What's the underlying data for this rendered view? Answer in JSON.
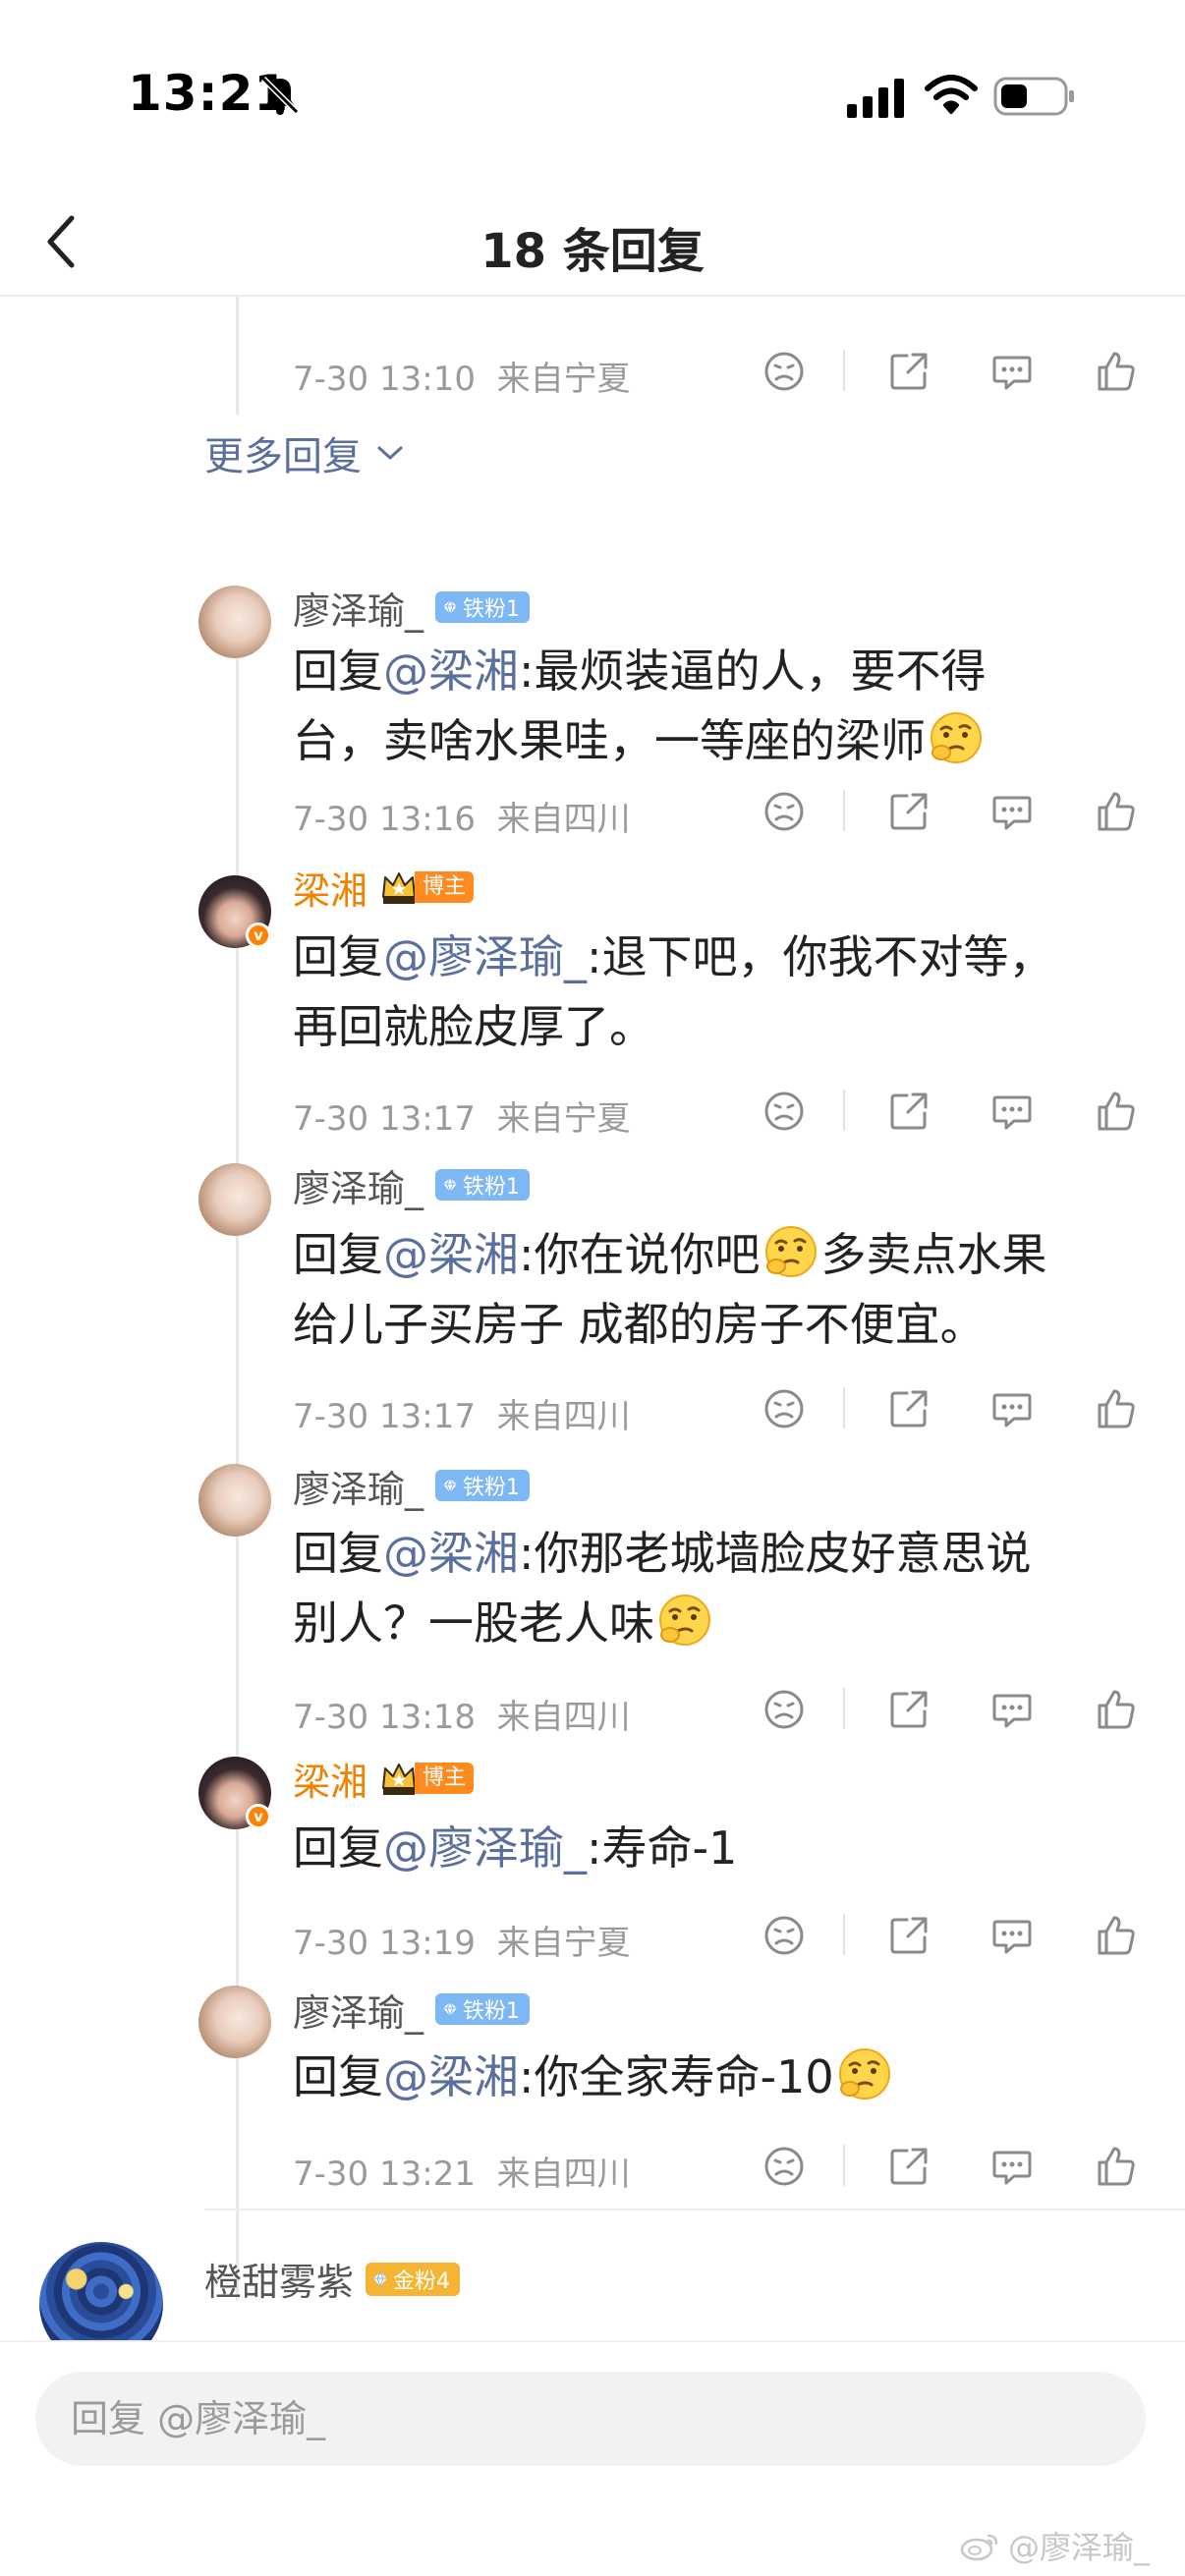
{
  "status_bar": {
    "time": "13:21"
  },
  "nav": {
    "title": "18 条回复"
  },
  "top_meta": {
    "date": "7-30 13:10",
    "location": "来自宁夏"
  },
  "more_replies": "更多回复",
  "replies": [
    {
      "name": "廖泽瑜_",
      "badge": "铁粉1",
      "prefix": "回复",
      "mention": "@梁湘",
      "line1": ":最烦装逼的人，要不得",
      "line2": "台，卖啥水果哇，一等座的梁师",
      "date": "7-30 13:16",
      "location": "来自四川"
    },
    {
      "name": "梁湘",
      "badge": "博主",
      "prefix": "回复",
      "mention": "@廖泽瑜_",
      "line1": ":退下吧，你我不对等，",
      "line2": "再回就脸皮厚了。",
      "date": "7-30 13:17",
      "location": "来自宁夏"
    },
    {
      "name": "廖泽瑜_",
      "badge": "铁粉1",
      "prefix": "回复",
      "mention": "@梁湘",
      "line1a": ":你在说你吧",
      "line1b": "多卖点水果",
      "line2": "给儿子买房子 成都的房子不便宜。",
      "date": "7-30 13:17",
      "location": "来自四川"
    },
    {
      "name": "廖泽瑜_",
      "badge": "铁粉1",
      "prefix": "回复",
      "mention": "@梁湘",
      "line1": ":你那老城墙脸皮好意思说",
      "line2": "别人？一股老人味",
      "date": "7-30 13:18",
      "location": "来自四川"
    },
    {
      "name": "梁湘",
      "badge": "博主",
      "prefix": "回复",
      "mention": "@廖泽瑜_",
      "line1": ":寿命-1",
      "date": "7-30 13:19",
      "location": "来自宁夏"
    },
    {
      "name": "廖泽瑜_",
      "badge": "铁粉1",
      "prefix": "回复",
      "mention": "@梁湘",
      "line1": ":你全家寿命-10",
      "date": "7-30 13:21",
      "location": "来自四川"
    }
  ],
  "next_comment": {
    "name": "橙甜雾紫",
    "badge": "金粉4"
  },
  "input": {
    "placeholder": "回复 @廖泽瑜_"
  },
  "watermark": "@廖泽瑜_",
  "colors": {
    "mention": "#5a6f9e",
    "owner": "#f08200",
    "fan_badge": "#7db7f4",
    "gold_badge": "#f5b533"
  }
}
